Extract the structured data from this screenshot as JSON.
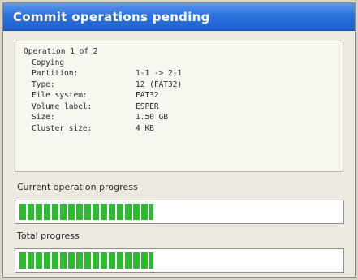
{
  "window": {
    "title": "Commit operations pending"
  },
  "operation": {
    "header": "Operation 1 of 2",
    "action": "Copying",
    "rows": [
      {
        "label": "Partition:",
        "value": "1-1 -> 2-1"
      },
      {
        "label": "Type:",
        "value": "12 (FAT32)"
      },
      {
        "label": "File system:",
        "value": "FAT32"
      },
      {
        "label": "Volume label:",
        "value": "ESPER"
      },
      {
        "label": "Size:",
        "value": "1.50 GB"
      },
      {
        "label": "Cluster size:",
        "value": "4 KB"
      }
    ]
  },
  "progress": {
    "current_label": "Current operation progress",
    "current_value": 0.42,
    "total_label": "Total progress",
    "total_value": 0.42
  },
  "colors": {
    "title_bar": "#2d72df",
    "progress_fill": "#2fbb31"
  }
}
